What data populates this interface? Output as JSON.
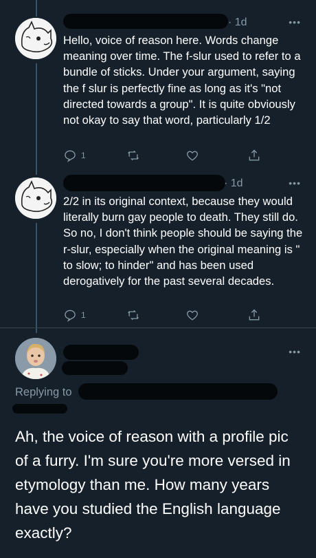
{
  "tweets": [
    {
      "time": "· 1d",
      "more": "•••",
      "text": "Hello, voice of reason here. Words change meaning over time. The f-slur used to refer to a bundle of sticks. Under your argument, saying the f slur is perfectly fine as long as it's \"not directed towards a group\". It is quite obviously not okay to say that word, particularly 1/2",
      "reply_count": "1",
      "icons": [
        "reply-icon",
        "retweet-icon",
        "like-icon",
        "share-icon"
      ]
    },
    {
      "time": "· 1d",
      "more": "•••",
      "text": "2/2 in its original context, because they would literally burn gay people to death. They still do. So no, I don't think people should be saying the r-slur, especially when the original meaning is \" to slow; to hinder\" and has been used derogatively for the past several decades.",
      "reply_count": "1",
      "icons": [
        "reply-icon",
        "retweet-icon",
        "like-icon",
        "share-icon"
      ]
    }
  ],
  "main_tweet": {
    "more": "•••",
    "replying_to": "Replying to",
    "text": "Ah, the voice of reason with a profile pic of a furry. I'm sure you're more versed in etymology than me. How many years have you studied the English language exactly?"
  },
  "colors": {
    "background": "#15202b",
    "muted": "#8899a6",
    "redaction": "#05080b"
  }
}
